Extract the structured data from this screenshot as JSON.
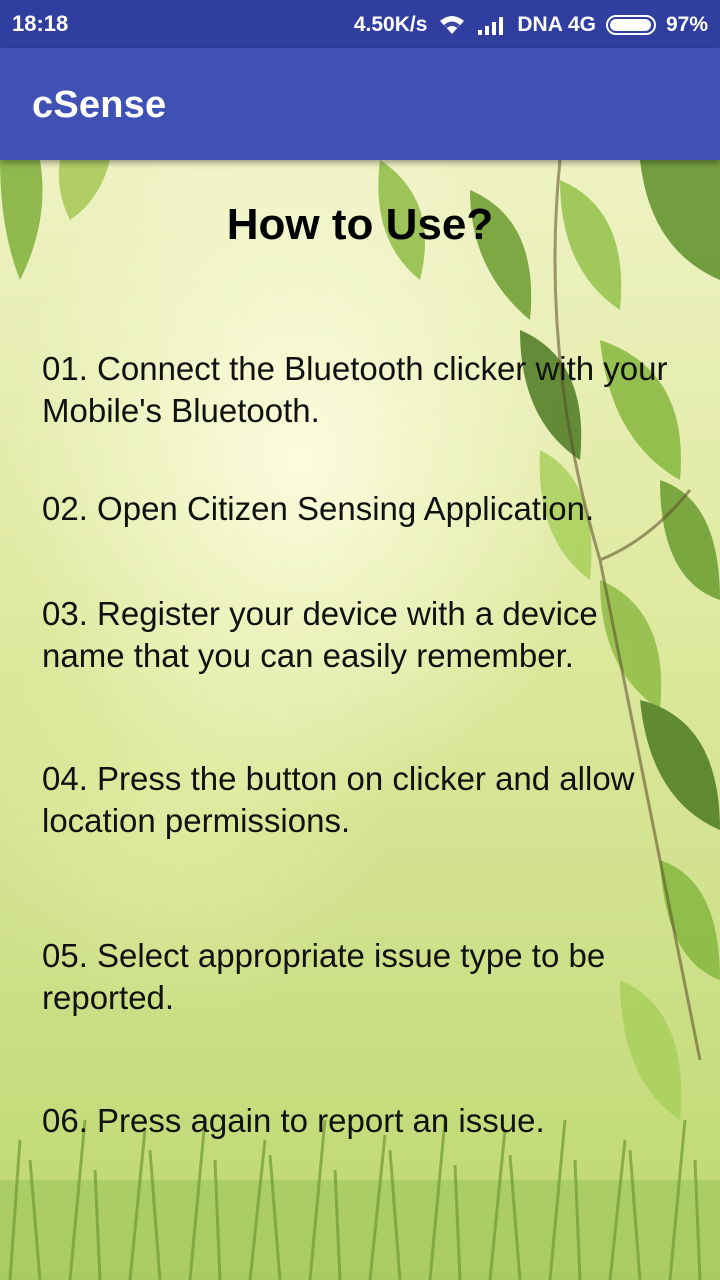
{
  "status_bar": {
    "time": "18:18",
    "network_speed": "4.50K/s",
    "carrier": "DNA 4G",
    "battery": "97%",
    "battery_level": 0.97,
    "icons": [
      "wifi-icon",
      "signal-icon",
      "battery-icon"
    ]
  },
  "app_bar": {
    "title": "cSense",
    "color": "#3f51b5"
  },
  "page": {
    "title": "How to Use?",
    "steps": [
      "01. Connect the Bluetooth clicker with your Mobile's Bluetooth.",
      "02. Open Citizen Sensing Application.",
      "03. Register your device with a device name that you can easily remember.",
      "04. Press the button on clicker and allow location permissions.",
      "05. Select appropriate issue type to be reported.",
      "06. Press again to report an issue."
    ]
  }
}
